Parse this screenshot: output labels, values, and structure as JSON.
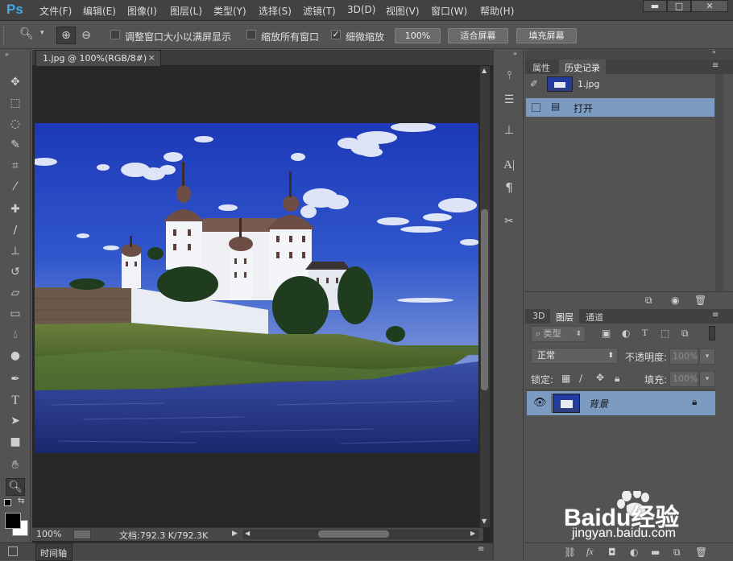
{
  "app": {
    "logo": "Ps"
  },
  "menu": [
    "文件(F)",
    "编辑(E)",
    "图像(I)",
    "图层(L)",
    "类型(Y)",
    "选择(S)",
    "滤镜(T)",
    "3D(D)",
    "视图(V)",
    "窗口(W)",
    "帮助(H)"
  ],
  "window_controls": {
    "minimize": "▬",
    "maximize": "□",
    "close": "✕"
  },
  "options_bar": {
    "resize_windows_label": "调整窗口大小以满屏显示",
    "resize_windows_checked": false,
    "zoom_all_label": "缩放所有窗口",
    "zoom_all_checked": false,
    "scrubby_zoom_label": "细微缩放",
    "scrubby_zoom_checked": true,
    "zoom_value": "100%",
    "fit_screen_label": "适合屏幕",
    "fill_screen_label": "填充屏幕"
  },
  "document": {
    "tab_title": "1.jpg @ 100%(RGB/8#)",
    "tab_close": "×",
    "zoom_status": "100%",
    "doc_info": "文档:792.3 K/792.3K"
  },
  "timeline": {
    "label": "时间轴"
  },
  "history_panel": {
    "tabs": [
      "属性",
      "历史记录"
    ],
    "active_tab": "历史记录",
    "snapshot_name": "1.jpg",
    "states": [
      {
        "label": "打开"
      }
    ]
  },
  "layers_panel": {
    "tabs": [
      "3D",
      "图层",
      "通道"
    ],
    "active_tab": "图层",
    "filter_kind": "类型",
    "blend_mode": "正常",
    "opacity_label": "不透明度:",
    "opacity_value": "100%",
    "lock_label": "锁定:",
    "fill_label": "填充:",
    "fill_value": "100%",
    "layers": [
      {
        "name": "背景",
        "visible": true,
        "locked": true
      }
    ]
  },
  "watermark": {
    "brand": "Baidu经验",
    "url": "jingyan.baidu.com"
  },
  "colors": {
    "accent_blue": "#41a9e8",
    "selection_row": "#7b9bc0",
    "canvas_bg": "#282828",
    "panel_bg": "#535353"
  }
}
